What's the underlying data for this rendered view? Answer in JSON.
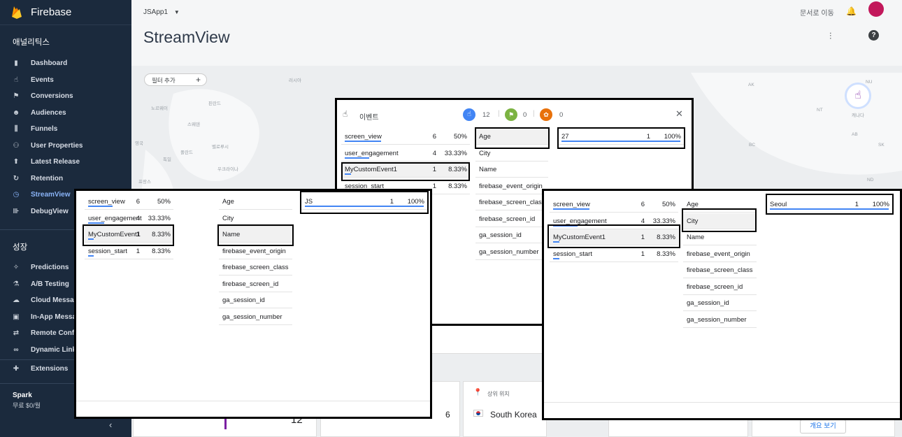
{
  "app": {
    "brand": "Firebase",
    "project": "JSApp1",
    "page_title": "StreamView",
    "docs_link": "문서로 이동"
  },
  "sidebar": {
    "analytics_title": "애널리틱스",
    "analytics_items": [
      {
        "label": "Dashboard",
        "icon": "bar-chart-icon"
      },
      {
        "label": "Events",
        "icon": "touch-icon"
      },
      {
        "label": "Conversions",
        "icon": "flag-icon"
      },
      {
        "label": "Audiences",
        "icon": "people-icon"
      },
      {
        "label": "Funnels",
        "icon": "funnel-icon"
      },
      {
        "label": "User Properties",
        "icon": "person-tag-icon"
      },
      {
        "label": "Latest Release",
        "icon": "release-icon"
      },
      {
        "label": "Retention",
        "icon": "retention-icon"
      },
      {
        "label": "StreamView",
        "icon": "clock-icon"
      },
      {
        "label": "DebugView",
        "icon": "debug-icon"
      }
    ],
    "growth_title": "성장",
    "growth_items": [
      {
        "label": "Predictions",
        "icon": "wand-icon"
      },
      {
        "label": "A/B Testing",
        "icon": "flask-icon"
      },
      {
        "label": "Cloud Messa",
        "icon": "cloud-icon"
      },
      {
        "label": "In-App Messa",
        "icon": "inapp-icon"
      },
      {
        "label": "Remote Conf",
        "icon": "remote-config-icon"
      },
      {
        "label": "Dynamic Link",
        "icon": "link-icon"
      }
    ],
    "extensions": "Extensions",
    "plan_name": "Spark",
    "plan_price": "무료 $0/월"
  },
  "filter": {
    "label": "필터 추가"
  },
  "map_labels": [
    "노르웨이",
    "핀란드",
    "스웨덴",
    "영국",
    "독일",
    "벨로루시",
    "폴란드",
    "우크라이나",
    "프랑스",
    "카자",
    "AK",
    "BC",
    "AB",
    "SK",
    "NT",
    "YT",
    "NU",
    "ND",
    "캐나다",
    "러시아"
  ],
  "event_panel": {
    "title": "이벤트",
    "stat_users": "12",
    "stat_conversions": "0",
    "stat_gifts": "0",
    "events": [
      {
        "name": "screen_view",
        "count": "6",
        "pct": "50%",
        "share": 0.5
      },
      {
        "name": "user_engagement",
        "count": "4",
        "pct": "33.33%",
        "share": 0.3333
      },
      {
        "name": "MyCustomEvent1",
        "count": "1",
        "pct": "8.33%",
        "share": 0.0833
      },
      {
        "name": "session_start",
        "count": "1",
        "pct": "8.33%",
        "share": 0.0833
      }
    ],
    "params": [
      "Age",
      "City",
      "Name",
      "firebase_event_origin",
      "firebase_screen_class",
      "firebase_screen_id",
      "ga_session_id",
      "ga_session_number"
    ],
    "value": {
      "name": "27",
      "count": "1",
      "pct": "100%",
      "share": 1.0
    }
  },
  "left_panel": {
    "events": [
      {
        "name": "screen_view",
        "count": "6",
        "pct": "50%",
        "share": 0.5
      },
      {
        "name": "user_engagement",
        "count": "4",
        "pct": "33.33%",
        "share": 0.3333
      },
      {
        "name": "MyCustomEvent1",
        "count": "1",
        "pct": "8.33%",
        "share": 0.0833
      },
      {
        "name": "session_start",
        "count": "1",
        "pct": "8.33%",
        "share": 0.0833
      }
    ],
    "params": [
      "Age",
      "City",
      "Name",
      "firebase_event_origin",
      "firebase_screen_class",
      "firebase_screen_id",
      "ga_session_id",
      "ga_session_number"
    ],
    "value": {
      "name": "JS",
      "count": "1",
      "pct": "100%",
      "share": 1.0
    }
  },
  "right_panel": {
    "events": [
      {
        "name": "screen_view",
        "count": "6",
        "pct": "50%",
        "share": 0.5
      },
      {
        "name": "user_engagement",
        "count": "4",
        "pct": "33.33%",
        "share": 0.3333
      },
      {
        "name": "MyCustomEvent1",
        "count": "1",
        "pct": "8.33%",
        "share": 0.0833
      },
      {
        "name": "session_start",
        "count": "1",
        "pct": "8.33%",
        "share": 0.0833
      }
    ],
    "params": [
      "Age",
      "City",
      "Name",
      "firebase_event_origin",
      "firebase_screen_class",
      "firebase_screen_id",
      "ga_session_id",
      "ga_session_number"
    ],
    "value": {
      "name": "Seoul",
      "count": "1",
      "pct": "100%",
      "share": 1.0
    }
  },
  "cards": {
    "location_title": "상위 위치",
    "location_value": "South Korea",
    "location_count": "6",
    "card1_value": "12",
    "overview_button": "개요 보기"
  },
  "colors": {
    "sidebar_bg": "#1b2a3d",
    "accent": "#4285f4",
    "active_nav": "#8ab4f8"
  }
}
